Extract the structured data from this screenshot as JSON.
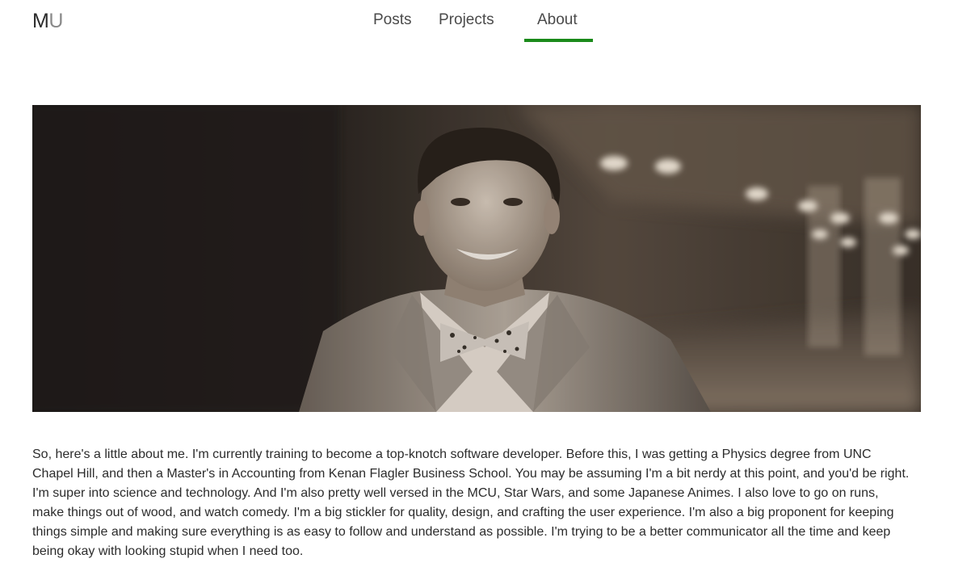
{
  "brand": {
    "logo_m": "M",
    "logo_u": "U"
  },
  "nav": {
    "items": [
      {
        "label": "Posts",
        "active": false
      },
      {
        "label": "Projects",
        "active": false
      },
      {
        "label": "About",
        "active": true
      }
    ],
    "active_color": "#1a8a1a"
  },
  "hero": {
    "subject": "portrait-photo"
  },
  "about": {
    "text": "So, here's a little about me. I'm currently training to become a top-knotch software developer. Before this, I was getting a Physics degree from UNC Chapel Hill, and then a Master's in Accounting from Kenan Flagler Business School. You may be assuming I'm a bit nerdy at this point, and you'd be right. I'm super into science and technology. And I'm also pretty well versed in the MCU, Star Wars, and some Japanese Animes. I also love to go on runs, make things out of wood, and watch comedy. I'm a big stickler for quality, design, and crafting the user experience. I'm also a big proponent for keeping things simple and making sure everything is as easy to follow and understand as possible. I'm trying to be a better communicator all the time and keep being okay with looking stupid when I need too."
  }
}
